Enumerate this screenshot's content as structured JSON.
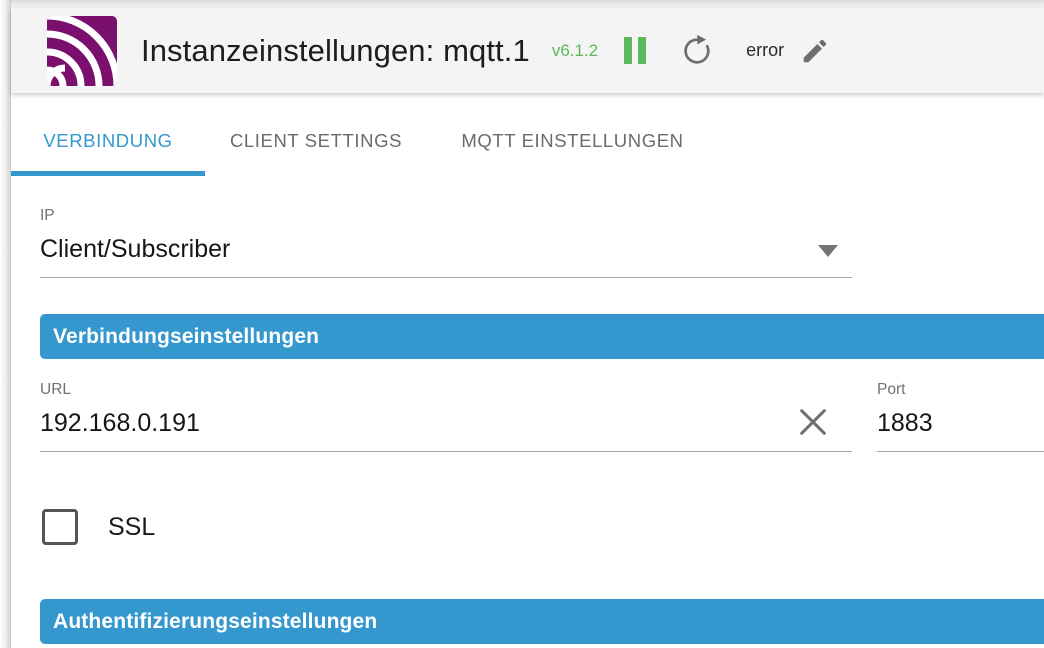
{
  "header": {
    "logo_icon": "iobroker-wifi-waves-logo",
    "title": "Instanzeinstellungen: mqtt.1",
    "version": "v6.1.2",
    "version_color": "#5cb85c",
    "pause_icon": "pause-icon",
    "pause_color": "#5cb85c",
    "refresh_icon": "refresh-icon",
    "status": "error",
    "edit_icon": "pencil-edit-icon",
    "background": "#f4f4f4"
  },
  "tabs": {
    "accent": "#3498cf",
    "items": [
      {
        "label": "VERBINDUNG",
        "active": true
      },
      {
        "label": "CLIENT SETTINGS",
        "active": false
      },
      {
        "label": "MQTT EINSTELLUNGEN",
        "active": false
      }
    ]
  },
  "form": {
    "ip": {
      "label": "IP",
      "value": "Client/Subscriber",
      "dropdown_icon": "chevron-down-icon"
    },
    "connection_section": {
      "title": "Verbindungseinstellungen",
      "color": "#3498cf"
    },
    "url": {
      "label": "URL",
      "value": "192.168.0.191",
      "clear_icon": "close-x-icon"
    },
    "port": {
      "label": "Port",
      "value": "1883"
    },
    "ssl": {
      "label": "SSL",
      "checked": false,
      "checkbox_icon": "checkbox-unchecked-icon"
    },
    "auth_section": {
      "title": "Authentifizierungseinstellungen",
      "color": "#3498cf"
    }
  }
}
